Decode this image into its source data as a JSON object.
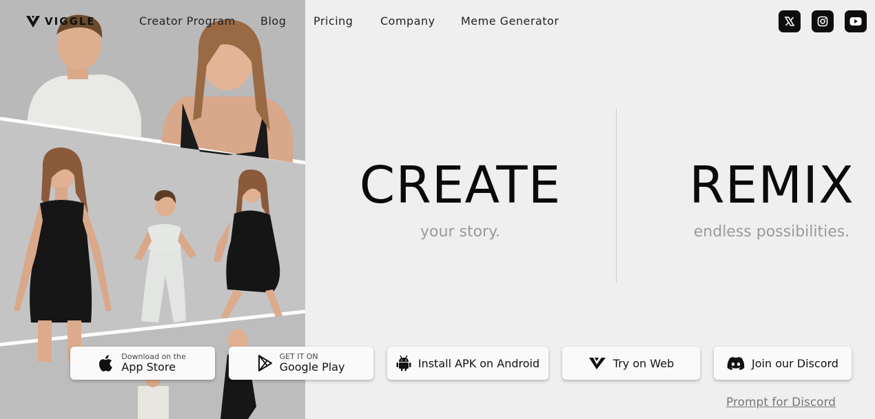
{
  "brand": {
    "name": "VIGGLE"
  },
  "nav": {
    "items": [
      {
        "label": "Creator Program"
      },
      {
        "label": "Blog"
      },
      {
        "label": "Pricing"
      },
      {
        "label": "Company"
      },
      {
        "label": "Meme Generator"
      }
    ]
  },
  "social": [
    {
      "icon": "x-icon"
    },
    {
      "icon": "instagram-icon"
    },
    {
      "icon": "youtube-icon"
    }
  ],
  "hero": {
    "left": {
      "title": "CREATE",
      "subtitle": "your story."
    },
    "right": {
      "title": "REMIX",
      "subtitle": "endless possibilities."
    }
  },
  "buttons": {
    "app_store": {
      "small": "Download on the",
      "big": "App Store",
      "icon": "apple-icon"
    },
    "google_play": {
      "small": "GET IT ON",
      "big": "Google Play",
      "icon": "google-play-icon"
    },
    "android_apk": {
      "label": "Install APK on Android",
      "icon": "android-icon"
    },
    "web": {
      "label": "Try on Web",
      "icon": "viggle-logo-icon"
    },
    "discord": {
      "label": "Join our Discord",
      "icon": "discord-icon"
    }
  },
  "links": {
    "prompt_discord": "Prompt for Discord"
  },
  "colors": {
    "background": "#efefef",
    "accent": "#0d0d0d",
    "muted_text": "#9a9a9a"
  }
}
